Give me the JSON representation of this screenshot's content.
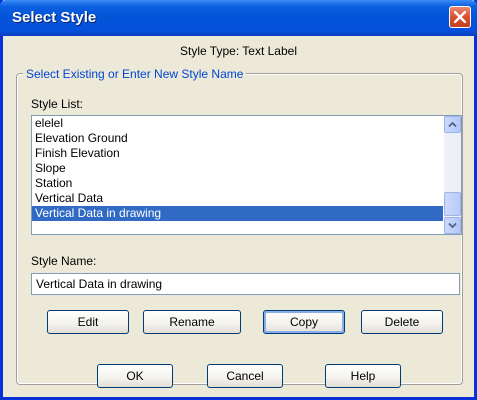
{
  "window": {
    "title": "Select Style",
    "style_type": "Style Type: Text Label"
  },
  "group": {
    "legend": "Select Existing or Enter New Style Name"
  },
  "style_list": {
    "label": "Style List:",
    "items": [
      "elelel",
      "Elevation Ground",
      "Finish Elevation",
      "Slope",
      "Station",
      "Vertical Data",
      "Vertical Data in drawing"
    ],
    "selected_index": 6
  },
  "style_name": {
    "label": "Style Name:",
    "value": "Vertical Data in drawing"
  },
  "actions": {
    "edit": "Edit",
    "rename": "Rename",
    "copy": "Copy",
    "delete": "Delete"
  },
  "footer": {
    "ok": "OK",
    "cancel": "Cancel",
    "help": "Help"
  },
  "icons": {
    "close": "close-icon",
    "scroll_up": "chevron-up-icon",
    "scroll_down": "chevron-down-icon"
  },
  "colors": {
    "title_bar": "#0454d8",
    "selection": "#316ac5",
    "legend_text": "#0046d5",
    "close_button": "#d9502f",
    "dialog_face": "#ece9d8"
  }
}
